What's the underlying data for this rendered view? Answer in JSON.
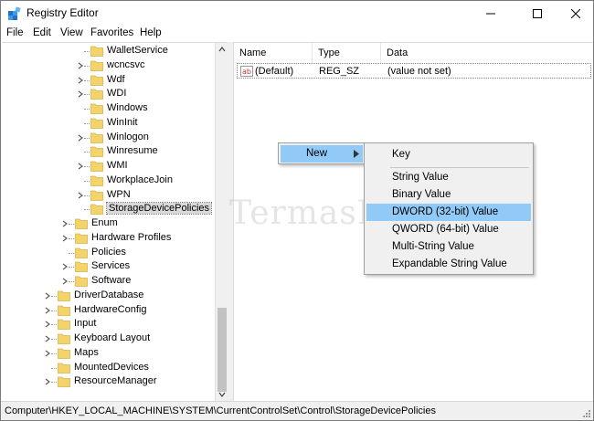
{
  "window": {
    "title": "Registry Editor"
  },
  "menu": [
    "File",
    "Edit",
    "View",
    "Favorites",
    "Help"
  ],
  "tree": {
    "items": [
      {
        "label": "WalletService",
        "depth": 3,
        "expander": "none"
      },
      {
        "label": "wcncsvc",
        "depth": 3,
        "expander": "plus"
      },
      {
        "label": "Wdf",
        "depth": 3,
        "expander": "plus"
      },
      {
        "label": "WDI",
        "depth": 3,
        "expander": "plus"
      },
      {
        "label": "Windows",
        "depth": 3,
        "expander": "none"
      },
      {
        "label": "WinInit",
        "depth": 3,
        "expander": "none"
      },
      {
        "label": "Winlogon",
        "depth": 3,
        "expander": "plus"
      },
      {
        "label": "Winresume",
        "depth": 3,
        "expander": "none"
      },
      {
        "label": "WMI",
        "depth": 3,
        "expander": "plus"
      },
      {
        "label": "WorkplaceJoin",
        "depth": 3,
        "expander": "none"
      },
      {
        "label": "WPN",
        "depth": 3,
        "expander": "plus"
      },
      {
        "label": "StorageDevicePolicies",
        "depth": 3,
        "expander": "none",
        "selected": true
      },
      {
        "label": "Enum",
        "depth": 2,
        "expander": "plus"
      },
      {
        "label": "Hardware Profiles",
        "depth": 2,
        "expander": "plus"
      },
      {
        "label": "Policies",
        "depth": 2,
        "expander": "none"
      },
      {
        "label": "Services",
        "depth": 2,
        "expander": "plus"
      },
      {
        "label": "Software",
        "depth": 2,
        "expander": "plus"
      },
      {
        "label": "DriverDatabase",
        "depth": 1,
        "expander": "plus"
      },
      {
        "label": "HardwareConfig",
        "depth": 1,
        "expander": "plus"
      },
      {
        "label": "Input",
        "depth": 1,
        "expander": "plus"
      },
      {
        "label": "Keyboard Layout",
        "depth": 1,
        "expander": "plus"
      },
      {
        "label": "Maps",
        "depth": 1,
        "expander": "plus"
      },
      {
        "label": "MountedDevices",
        "depth": 1,
        "expander": "none"
      },
      {
        "label": "ResourceManager",
        "depth": 1,
        "expander": "plus"
      }
    ]
  },
  "list": {
    "columns": [
      "Name",
      "Type",
      "Data"
    ],
    "rows": [
      {
        "name": "(Default)",
        "type": "REG_SZ",
        "data": "(value not set)"
      }
    ]
  },
  "context_menu": {
    "new_label": "New",
    "submenu": [
      {
        "label": "Key",
        "highlighted": false
      },
      {
        "label": "String Value",
        "highlighted": false
      },
      {
        "label": "Binary Value",
        "highlighted": false
      },
      {
        "label": "DWORD (32-bit) Value",
        "highlighted": true
      },
      {
        "label": "QWORD (64-bit) Value",
        "highlighted": false
      },
      {
        "label": "Multi-String Value",
        "highlighted": false
      },
      {
        "label": "Expandable String Value",
        "highlighted": false
      }
    ]
  },
  "watermark": "TermasMedia",
  "statusbar": {
    "path": "Computer\\HKEY_LOCAL_MACHINE\\SYSTEM\\CurrentControlSet\\Control\\StorageDevicePolicies"
  },
  "colors": {
    "highlight": "#91c9f7",
    "folder": "#f5d36b",
    "selected_row": "#d9d9d9"
  },
  "icons": {
    "app": "registry-editor-icon",
    "folder": "folder-icon",
    "value": "string-value-icon"
  }
}
